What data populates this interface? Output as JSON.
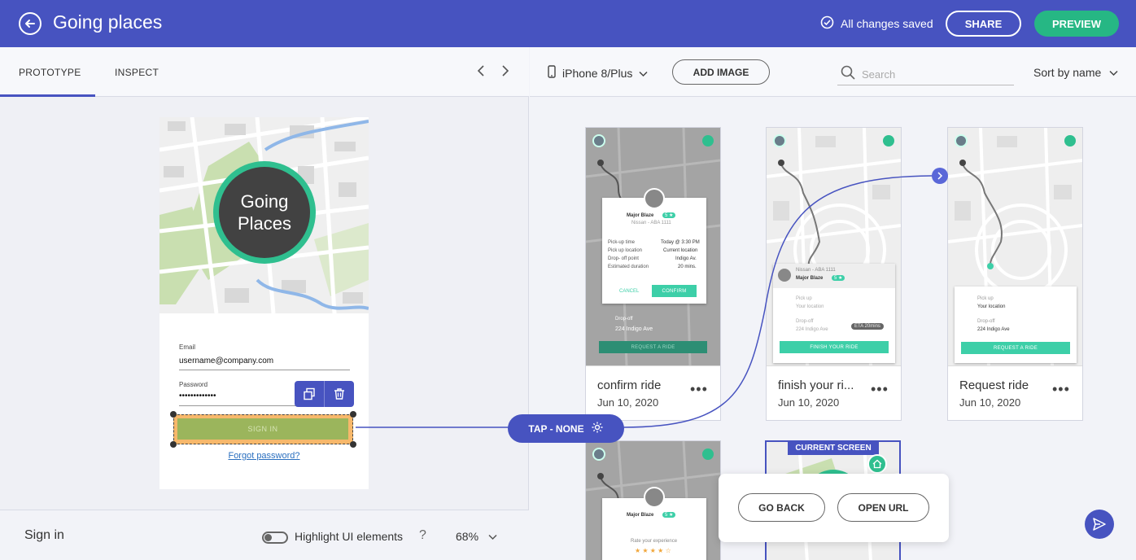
{
  "header": {
    "title": "Going places",
    "saved_status": "All changes saved",
    "share_label": "SHARE",
    "preview_label": "PREVIEW"
  },
  "left": {
    "tabs": [
      {
        "label": "PROTOTYPE"
      },
      {
        "label": "INSPECT"
      }
    ],
    "phone": {
      "logo_line1": "Going",
      "logo_line2": "Places",
      "email_label": "Email",
      "email_value": "username@company.com",
      "password_label": "Password",
      "password_value": "•••••••••••••",
      "signin_label": "SIGN IN",
      "forgot_label": "Forgot password?"
    },
    "footer": {
      "screen_name": "Sign in",
      "highlight_label": "Highlight UI elements",
      "help": "?",
      "zoom": "68%"
    }
  },
  "right": {
    "device": "iPhone 8/Plus",
    "add_image_label": "ADD IMAGE",
    "search_placeholder": "Search",
    "sort_label": "Sort by name",
    "cards": [
      {
        "name": "confirm ride",
        "date": "Jun 10, 2020"
      },
      {
        "name": "finish your ri...",
        "date": "Jun 10, 2020"
      },
      {
        "name": "Request ride",
        "date": "Jun 10, 2020"
      }
    ],
    "thumb_texts": {
      "driver_name": "Major Blaze",
      "rating": "5 ★",
      "car": "Nissan - ABA 1111",
      "pickup_time_label": "Pick-up time",
      "pickup_time_value": "Today @ 3:30 PM",
      "pickup_location_label": "Pick up location",
      "pickup_location_value": "Current location",
      "dropoff_point_label": "Drop- off point",
      "dropoff_point_value": "Indigo Av.",
      "duration_label": "Estimated duration",
      "duration_value": "20 mins.",
      "cancel": "CANCEL",
      "confirm": "CONFIRM",
      "dropoff_label": "Drop-off",
      "dropoff_value": "224 Indigo Ave",
      "request": "REQUEST A RIDE",
      "pickup_label": "Pick up",
      "your_location": "Your location",
      "eta": "ETA 20mins",
      "finish": "FINISH YOUR RIDE",
      "rate": "Rate your experience",
      "stars": "★ ★ ★ ★ ☆"
    },
    "tap_label": "TAP - NONE",
    "current_screen_label": "CURRENT SCREEN",
    "go_back_label": "GO BACK",
    "open_url_label": "OPEN URL"
  },
  "colors": {
    "brand": "#4753c0",
    "accent": "#26b784",
    "selection": "#f7b86b"
  }
}
